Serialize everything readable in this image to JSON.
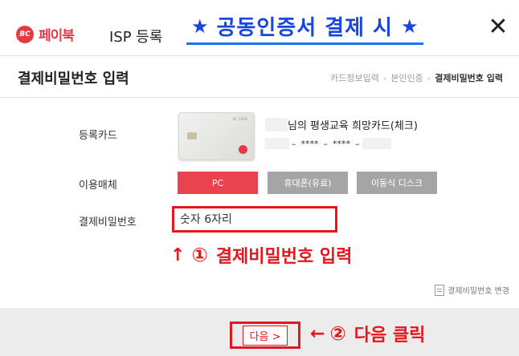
{
  "header": {
    "logo_mark": "BC",
    "logo_text": "페이북",
    "title": "ISP 등록",
    "banner_text": "공동인증서 결제 시",
    "banner_star": "★",
    "close_glyph": "✕"
  },
  "subheader": {
    "title": "결제비밀번호 입력",
    "breadcrumb": [
      "카드정보입력",
      "본인인증",
      "결제비밀번호 입력"
    ],
    "separator": "›"
  },
  "card": {
    "label": "등록카드",
    "brand": "BC CARD",
    "name_suffix": "님의 평생교육 희망카드(체크)",
    "number": [
      "****",
      "****"
    ],
    "dash": "–"
  },
  "media": {
    "label": "이용매체",
    "options": [
      "PC",
      "휴대폰(유료)",
      "이동식 디스크"
    ],
    "selected": "PC"
  },
  "password": {
    "label": "결제비밀번호",
    "placeholder": "숫자 6자리"
  },
  "annotations": {
    "step1_arrow": "↑",
    "step1_num": "①",
    "step1_text": "결제비밀번호 입력",
    "step2_arrow": "←",
    "step2_num": "②",
    "step2_text": "다음 클릭"
  },
  "change_password": "결제비밀번호 변경",
  "footer": {
    "next_label": "다음 >"
  },
  "colors": {
    "brand_red": "#e63946",
    "annotation_red": "#e5161c",
    "banner_blue": "#1a46e0",
    "inactive_gray": "#a5a5a5",
    "footer_bg": "#ececec"
  }
}
